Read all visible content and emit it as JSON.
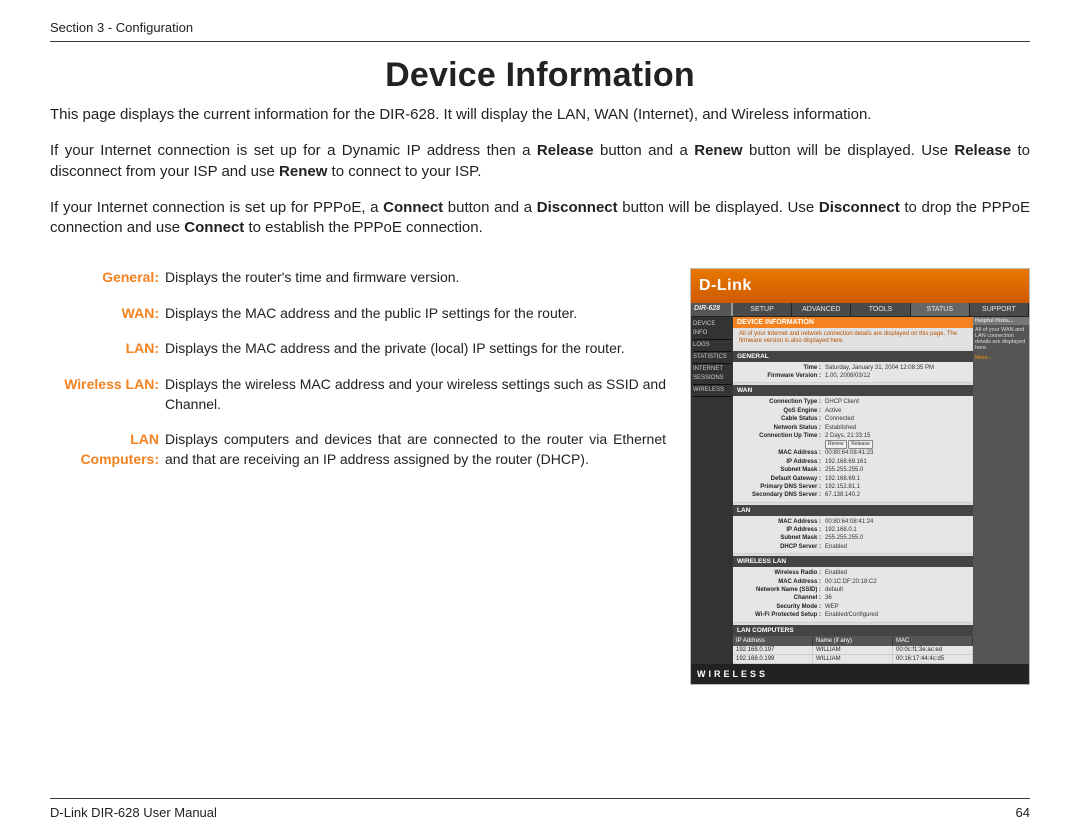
{
  "header": "Section 3 - Configuration",
  "title": "Device Information",
  "intro": {
    "p1": "This page displays the current information for the DIR-628. It will display the LAN, WAN (Internet), and Wireless information.",
    "p2a": "If your Internet connection is set up for a Dynamic IP address then a ",
    "p2b": "Release",
    "p2c": " button and a ",
    "p2d": "Renew",
    "p2e": " button will be displayed. Use ",
    "p2f": "Release",
    "p2g": " to disconnect from your ISP and use ",
    "p2h": "Renew",
    "p2i": " to connect to your ISP.",
    "p3a": "If your Internet connection is set up for PPPoE, a ",
    "p3b": "Connect",
    "p3c": " button and a ",
    "p3d": "Disconnect",
    "p3e": " button will be displayed. Use ",
    "p3f": "Disconnect",
    "p3g": " to drop the PPPoE connection and use ",
    "p3h": "Connect",
    "p3i": " to establish the PPPoE connection."
  },
  "defs": [
    {
      "term": "General:",
      "desc": "Displays the router's time and firmware version."
    },
    {
      "term": "WAN:",
      "desc": "Displays the MAC address and the public IP settings for the router."
    },
    {
      "term": "LAN:",
      "desc": "Displays the MAC address and the private (local) IP settings for the router."
    },
    {
      "term": "Wireless LAN:",
      "desc": "Displays the wireless MAC address and your wireless settings such as SSID and Channel."
    },
    {
      "term": "LAN Computers:",
      "desc": "Displays computers and devices that are connected to the router via Ethernet and that are receiving an IP address assigned by the router (DHCP)."
    }
  ],
  "ss": {
    "brand": "D-Link",
    "model": "DIR-628",
    "tabs": [
      "SETUP",
      "ADVANCED",
      "TOOLS",
      "STATUS",
      "SUPPORT"
    ],
    "activeTab": 3,
    "side": [
      "DEVICE INFO",
      "LOGS",
      "STATISTICS",
      "INTERNET SESSIONS",
      "WIRELESS"
    ],
    "right": {
      "heading": "Helpful Hints...",
      "text": "All of your WAN and LAN connection details are displayed here.",
      "more": "More..."
    },
    "titlebar": "DEVICE INFORMATION",
    "note": "All of your Internet and network connection details are displayed on this page. The firmware version is also displayed here.",
    "sections": {
      "general": {
        "label": "GENERAL",
        "rows": [
          {
            "k": "Time :",
            "v": "Saturday, January 31, 2004 12:08:35 PM"
          },
          {
            "k": "Firmware Version :",
            "v": "1.00,  2008/03/12"
          }
        ]
      },
      "wan": {
        "label": "WAN",
        "rows": [
          {
            "k": "Connection Type :",
            "v": "DHCP Client"
          },
          {
            "k": "QoS Engine :",
            "v": "Active"
          },
          {
            "k": "Cable Status :",
            "v": "Connected"
          },
          {
            "k": "Network Status :",
            "v": "Established"
          },
          {
            "k": "Connection Up Time :",
            "v": "2 Days, 21:33:15"
          },
          {
            "k": "MAC Address :",
            "v": "00:80:64:08:41:23"
          },
          {
            "k": "IP Address :",
            "v": "192.168.69.161"
          },
          {
            "k": "Subnet Mask :",
            "v": "255.255.255.0"
          },
          {
            "k": "Default Gateway :",
            "v": "192.168.69.1"
          },
          {
            "k": "Primary DNS Server :",
            "v": "192.152.81.1"
          },
          {
            "k": "Secondary DNS Server :",
            "v": "67.138.140.2"
          }
        ]
      },
      "lan": {
        "label": "LAN",
        "rows": [
          {
            "k": "MAC Address :",
            "v": "00:80:64:08:41:24"
          },
          {
            "k": "IP Address :",
            "v": "192.168.0.1"
          },
          {
            "k": "Subnet Mask :",
            "v": "255.255.255.0"
          },
          {
            "k": "DHCP Server :",
            "v": "Enabled"
          }
        ]
      },
      "wlan": {
        "label": "WIRELESS LAN",
        "rows": [
          {
            "k": "Wireless Radio :",
            "v": "Enabled"
          },
          {
            "k": "MAC Address :",
            "v": "00:1C:DF:20:18:C2"
          },
          {
            "k": "Network Name (SSID) :",
            "v": "default"
          },
          {
            "k": "Channel :",
            "v": "36"
          },
          {
            "k": "Security Mode :",
            "v": "WEP"
          },
          {
            "k": "Wi-Fi Protected Setup :",
            "v": "Enabled/Configured"
          }
        ]
      },
      "lanc": {
        "label": "LAN COMPUTERS",
        "cols": [
          "IP Address",
          "Name (if any)",
          "MAC"
        ],
        "rows": [
          [
            "192.168.0.197",
            "WILLIAM",
            "00:0c:f1:3e:ac:ed"
          ],
          [
            "192.168.0.199",
            "WILLIAM",
            "00:16:17:44:4c:d5"
          ]
        ]
      }
    },
    "btns": {
      "renew": "Renew",
      "release": "Release"
    },
    "wireless": "WIRELESS"
  },
  "footer": {
    "left": "D-Link DIR-628 User Manual",
    "page": "64"
  }
}
